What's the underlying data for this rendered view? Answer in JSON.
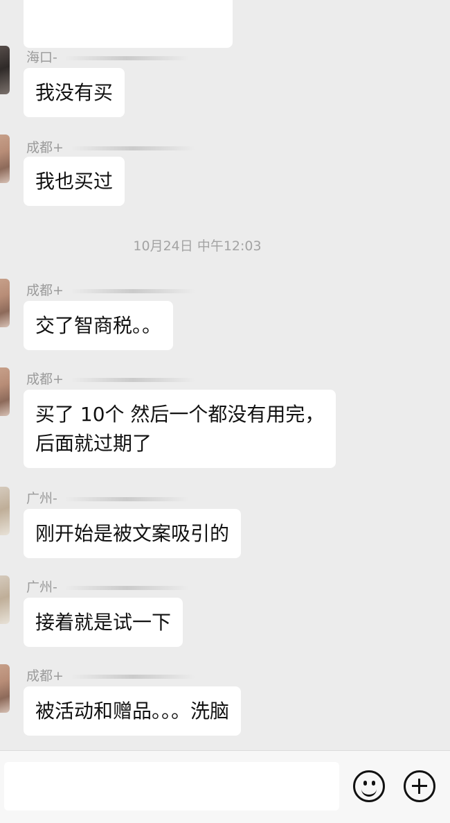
{
  "timestamp": "10月24日 中午12:03",
  "messages": [
    {
      "sender": "海口-",
      "text": "我没有买"
    },
    {
      "sender": "成都+",
      "text": "我也买过"
    },
    {
      "sender": "成都+",
      "text": "交了智商税。。"
    },
    {
      "sender": "成都+",
      "lines": [
        "买了 10个 然后一个都没有用完，",
        "后面就过期了"
      ]
    },
    {
      "sender": "广州-",
      "text": "刚开始是被文案吸引的"
    },
    {
      "sender": "广州-",
      "text": "接着就是试一下"
    },
    {
      "sender": "成都+",
      "text": "被活动和赠品。。。洗脑"
    }
  ],
  "input": {
    "placeholder": ""
  },
  "icons": {
    "emoji": "emoji-face-icon",
    "more": "plus-circle-icon"
  }
}
